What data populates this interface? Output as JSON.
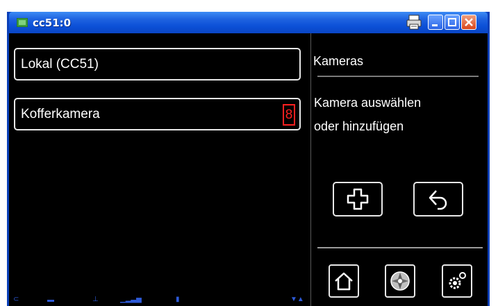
{
  "window": {
    "title": "cc51:0",
    "titlebar_icons": [
      "app-icon",
      "printer-icon",
      "minimize-icon",
      "maximize-icon",
      "close-icon"
    ]
  },
  "camera_list": [
    {
      "label": "Lokal (CC51)"
    },
    {
      "label": "Kofferkamera",
      "badge": "8"
    }
  ],
  "side_panel": {
    "title": "Kameras",
    "instruction_line1": "Kamera auswählen",
    "instruction_line2": "oder hinzufügen",
    "buttons": {
      "add_icon": "plus-icon",
      "back_icon": "back-arrow-icon"
    },
    "nav": {
      "home_icon": "home-icon",
      "media_icon": "media-icon",
      "settings_icon": "gears-icon"
    }
  },
  "colors": {
    "titlebar": "#0b4fd6",
    "background": "#000000",
    "text": "#ffffff",
    "badge": "#ff2020"
  }
}
